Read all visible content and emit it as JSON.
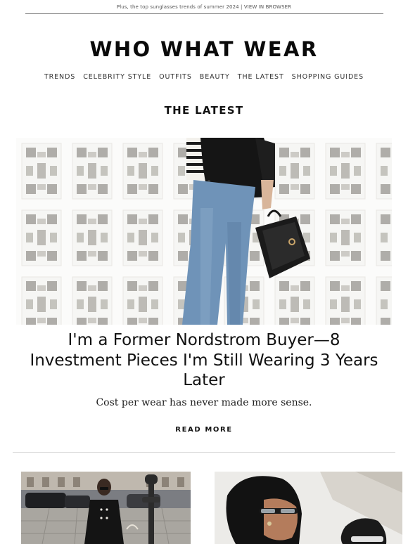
{
  "preheader": {
    "text": "Plus, the top sunglasses trends of summer 2024",
    "separator": "|",
    "link": "VIEW IN BROWSER"
  },
  "brand": {
    "logo": "WHO WHAT WEAR"
  },
  "nav": {
    "items": [
      "TRENDS",
      "CELEBRITY STYLE",
      "OUTFITS",
      "BEAUTY",
      "THE LATEST",
      "SHOPPING GUIDES"
    ]
  },
  "section": {
    "title": "THE LATEST"
  },
  "feature": {
    "headline": "I'm a Former Nordstrom Buyer—8 Investment Pieces I'm Still Wearing 3 Years Later",
    "dek": "Cost per wear has never made more sense.",
    "cta": "READ MORE"
  },
  "colors": {
    "text": "#111111",
    "muted": "#555555",
    "rule": "#d8d8d8",
    "brick": "#ffffff",
    "shadow": "#b9b7b2",
    "denim": "#6f93b8",
    "blazer": "#151515"
  }
}
